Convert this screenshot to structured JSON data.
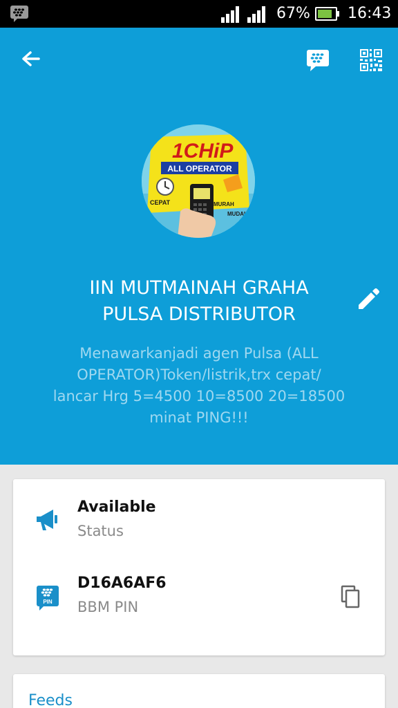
{
  "status_bar": {
    "battery_percent": "67%",
    "time": "16:43",
    "icons": [
      "bbm-notification-icon",
      "signal-icon",
      "signal-icon",
      "battery-icon"
    ]
  },
  "toolbar": {
    "icons": [
      "back-arrow-icon",
      "bbm-chat-icon",
      "qr-code-icon"
    ]
  },
  "profile": {
    "avatar_text": {
      "brand": "1CHiP",
      "tagline": "ALL OPERATOR",
      "word_left": "CEPAT",
      "word_right_1": "MURAH",
      "word_right_2": "MUDAH"
    },
    "name_line1": "IIN MUTMAINAH GRAHA",
    "name_line2": "PULSA DISTRIBUTOR",
    "message_line1": "Menawarkanjadi agen Pulsa (ALL",
    "message_line2": "OPERATOR)Token/listrik,trx cepat/",
    "message_line3": "lancar Hrg 5=4500 10=8500 20=18500",
    "message_line4": "minat PING!!!"
  },
  "info_card": {
    "status_value": "Available",
    "status_label": "Status",
    "pin_value": "D16A6AF6",
    "pin_label": "BBM PIN",
    "pin_icon_text": "PIN"
  },
  "feeds": {
    "title": "Feeds"
  },
  "colors": {
    "header_bg": "#0e9ed8",
    "accent_blue": "#1a8fc9",
    "page_bg": "#e8e8e8"
  }
}
